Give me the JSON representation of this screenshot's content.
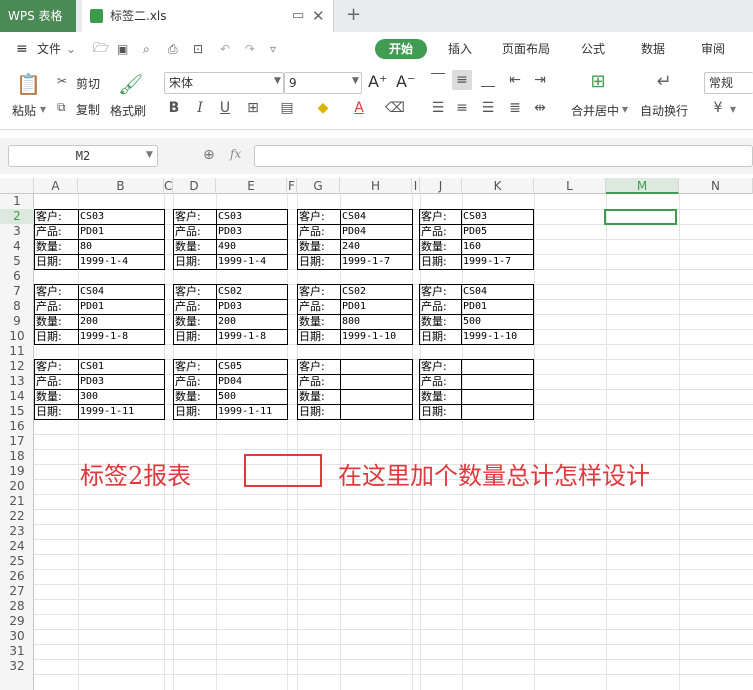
{
  "app": {
    "name": "WPS 表格",
    "doc_title": "标签二.xls"
  },
  "menu": {
    "file": "文件",
    "tabs": [
      "开始",
      "插入",
      "页面布局",
      "公式",
      "数据",
      "审阅"
    ]
  },
  "ribbon": {
    "paste": "粘贴",
    "cut": "剪切",
    "copy": "复制",
    "format_painter": "格式刷",
    "font": "宋体",
    "font_size": "9",
    "bold": "B",
    "italic": "I",
    "underline": "U",
    "merge": "合并居中",
    "wrap": "自动换行",
    "number_format": "常规",
    "grow": "A⁺",
    "shrink": "A⁻"
  },
  "formula_bar": {
    "name_box": "M2",
    "fx": "fx"
  },
  "columns": [
    "A",
    "B",
    "C",
    "D",
    "E",
    "F",
    "G",
    "H",
    "I",
    "J",
    "K",
    "L",
    "M",
    "N"
  ],
  "rows": [
    "1",
    "2",
    "3",
    "4",
    "5",
    "6",
    "7",
    "8",
    "9",
    "10",
    "11",
    "12",
    "13",
    "14",
    "15",
    "16",
    "17",
    "18",
    "19",
    "20",
    "21",
    "22",
    "23",
    "24",
    "25",
    "26",
    "27",
    "28",
    "29",
    "30",
    "31",
    "32"
  ],
  "labels": {
    "customer": "客户:",
    "product": "产品:",
    "quantity": "数量:",
    "date": "日期:"
  },
  "cards": [
    {
      "customer": "CS03",
      "product": "PD01",
      "quantity": "80",
      "date": "1999-1-4"
    },
    {
      "customer": "CS03",
      "product": "PD03",
      "quantity": "490",
      "date": "1999-1-4"
    },
    {
      "customer": "CS04",
      "product": "PD04",
      "quantity": "240",
      "date": "1999-1-7"
    },
    {
      "customer": "CS03",
      "product": "PD05",
      "quantity": "160",
      "date": "1999-1-7"
    },
    {
      "customer": "CS04",
      "product": "PD01",
      "quantity": "200",
      "date": "1999-1-8"
    },
    {
      "customer": "CS02",
      "product": "PD03",
      "quantity": "200",
      "date": "1999-1-8"
    },
    {
      "customer": "CS02",
      "product": "PD01",
      "quantity": "800",
      "date": "1999-1-10"
    },
    {
      "customer": "CS04",
      "product": "PD01",
      "quantity": "500",
      "date": "1999-1-10"
    },
    {
      "customer": "CS01",
      "product": "PD03",
      "quantity": "300",
      "date": "1999-1-11"
    },
    {
      "customer": "CS05",
      "product": "PD04",
      "quantity": "500",
      "date": "1999-1-11"
    },
    {
      "customer": "",
      "product": "",
      "quantity": "",
      "date": ""
    },
    {
      "customer": "",
      "product": "",
      "quantity": "",
      "date": ""
    }
  ],
  "annotations": {
    "report_title": "标签2报表",
    "question": "在这里加个数量总计怎样设计"
  },
  "colors": {
    "accent": "#3f9c52",
    "annotation": "#e0393e"
  }
}
